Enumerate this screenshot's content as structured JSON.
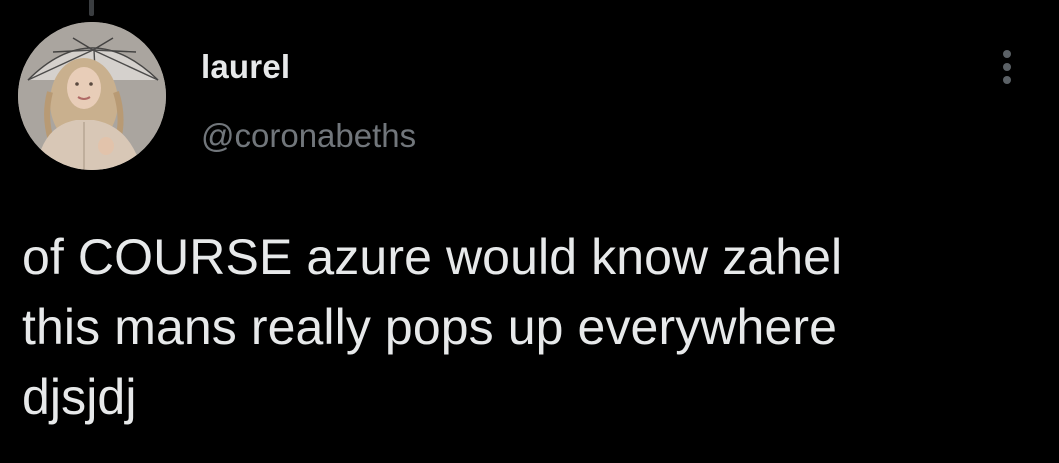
{
  "tweet": {
    "author": {
      "display_name": "laurel",
      "handle": "@coronabeths",
      "avatar_icon": "profile-photo-umbrella"
    },
    "text": "of COURSE azure would know zahel\nthis mans really pops up everywhere\ndjsjdj",
    "more_icon": "more-vertical-icon"
  },
  "colors": {
    "background": "#000000",
    "primary_text": "#e7e9ea",
    "secondary_text": "#71767b",
    "icon": "#5b6166"
  }
}
